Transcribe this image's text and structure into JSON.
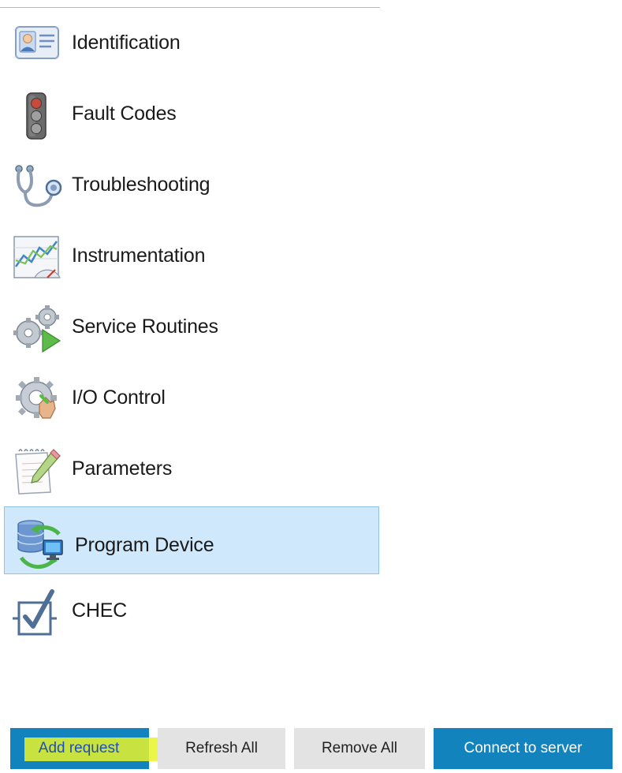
{
  "nav": {
    "items": [
      {
        "label": "Identification",
        "icon": "id-card-icon"
      },
      {
        "label": "Fault Codes",
        "icon": "traffic-light-icon"
      },
      {
        "label": "Troubleshooting",
        "icon": "stethoscope-icon"
      },
      {
        "label": "Instrumentation",
        "icon": "gauge-chart-icon"
      },
      {
        "label": "Service Routines",
        "icon": "gears-play-icon"
      },
      {
        "label": "I/O Control",
        "icon": "gear-hand-icon"
      },
      {
        "label": "Parameters",
        "icon": "notepad-pencil-icon"
      },
      {
        "label": "Program Device",
        "icon": "database-sync-icon",
        "selected": true
      },
      {
        "label": "CHEC",
        "icon": "checkbox-icon"
      }
    ]
  },
  "toolbar": {
    "add_request": "Add request",
    "refresh_all": "Refresh All",
    "remove_all": "Remove All",
    "connect_to_server": "Connect to server"
  },
  "colors": {
    "primary_button": "#1383bd",
    "secondary_button": "#e3e3e3",
    "selected_row": "#cfe8fb",
    "selected_border": "#8cc3ef",
    "highlight": "#e9f52a"
  }
}
